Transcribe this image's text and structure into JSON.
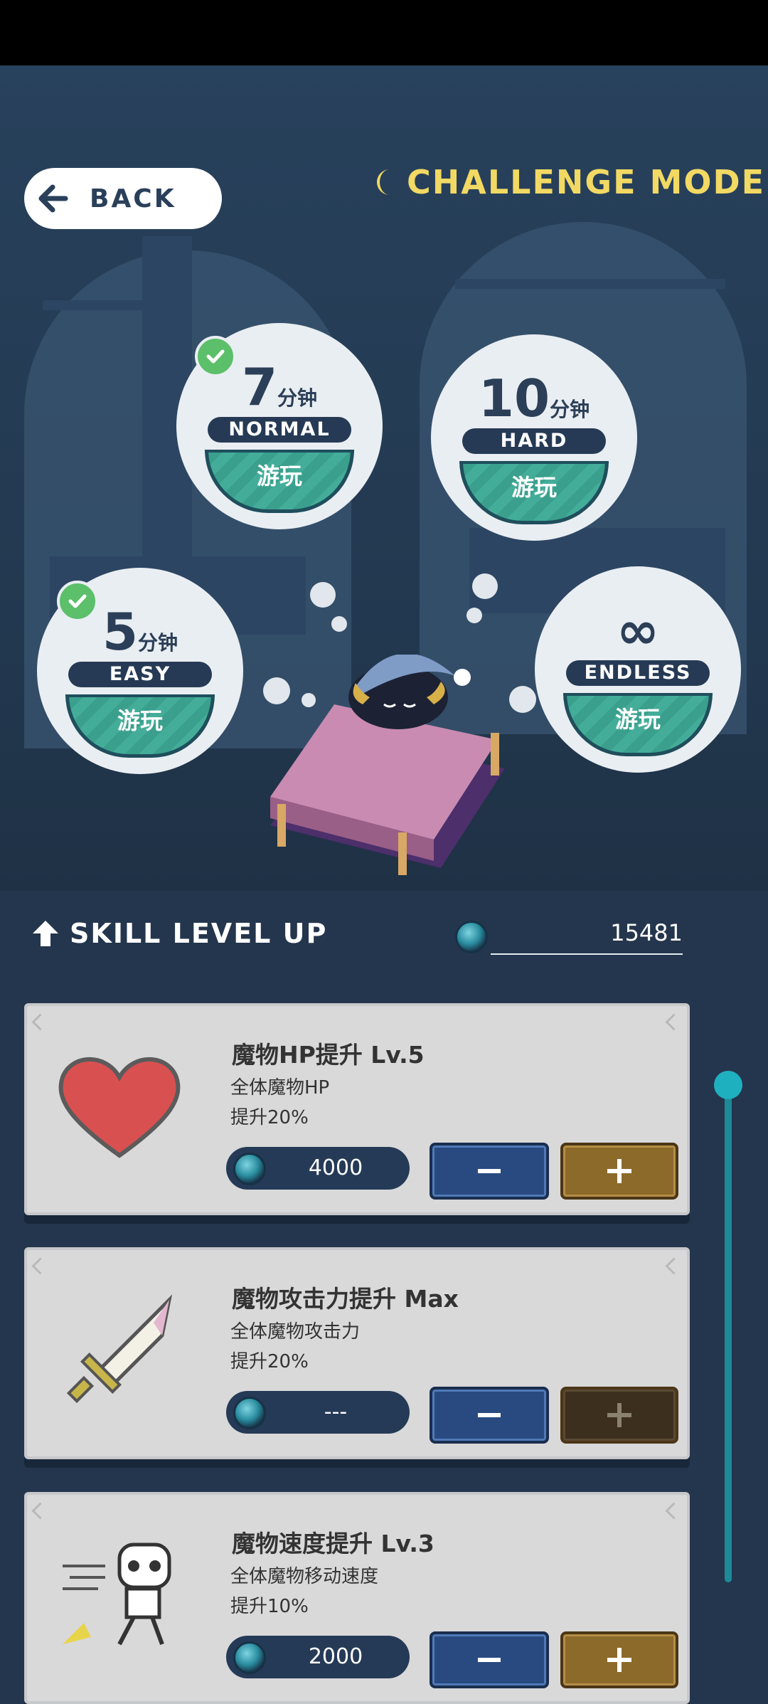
{
  "header": {
    "back_label": "BACK",
    "mode_title": "CHALLENGE MODE"
  },
  "modes": [
    {
      "time": "5",
      "unit": "分钟",
      "difficulty": "EASY",
      "play_label": "游玩",
      "completed": true
    },
    {
      "time": "7",
      "unit": "分钟",
      "difficulty": "NORMAL",
      "play_label": "游玩",
      "completed": true
    },
    {
      "time": "10",
      "unit": "分钟",
      "difficulty": "HARD",
      "play_label": "游玩",
      "completed": false
    },
    {
      "time": "∞",
      "unit": "",
      "difficulty": "ENDLESS",
      "play_label": "游玩",
      "completed": false
    }
  ],
  "skills_header": {
    "title": "SKILL LEVEL UP",
    "currency": "15481"
  },
  "skills": [
    {
      "name": "魔物HP提升 Lv.5",
      "desc_line1": "全体魔物HP",
      "desc_line2": "提升20%",
      "cost": "4000",
      "icon": "heart-icon",
      "plus_enabled": true
    },
    {
      "name": "魔物攻击力提升 Max",
      "desc_line1": "全体魔物攻击力",
      "desc_line2": "提升20%",
      "cost": "---",
      "icon": "sword-icon",
      "plus_enabled": false
    },
    {
      "name": "魔物速度提升 Lv.3",
      "desc_line1": "全体魔物移动速度",
      "desc_line2": "提升10%",
      "cost": "2000",
      "icon": "running-skeleton-icon",
      "plus_enabled": true
    }
  ],
  "colors": {
    "accent_title": "#f2d963",
    "background": "#24364d",
    "play_button": "#3aa08d",
    "scrollbar": "#1d8a98"
  }
}
